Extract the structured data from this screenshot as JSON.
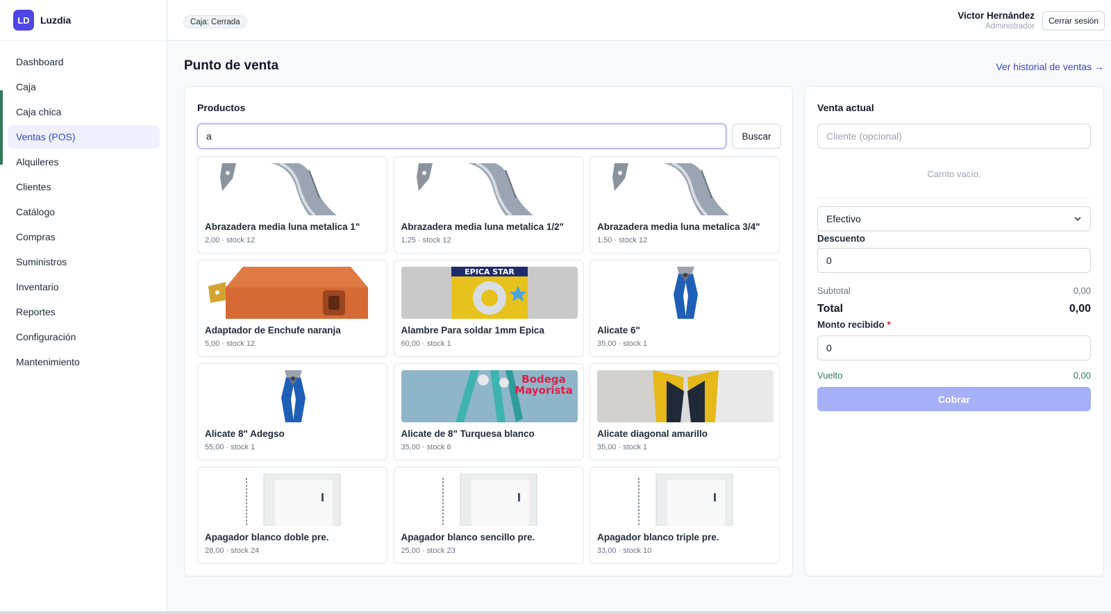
{
  "app": {
    "logo_text": "LD",
    "name": "Luzdia"
  },
  "sidebar": {
    "items": [
      {
        "label": "Dashboard",
        "active": false
      },
      {
        "label": "Caja",
        "active": false
      },
      {
        "label": "Caja chica",
        "active": false
      },
      {
        "label": "Ventas (POS)",
        "active": true
      },
      {
        "label": "Alquileres",
        "active": false
      },
      {
        "label": "Clientes",
        "active": false
      },
      {
        "label": "Catálogo",
        "active": false
      },
      {
        "label": "Compras",
        "active": false
      },
      {
        "label": "Suministros",
        "active": false
      },
      {
        "label": "Inventario",
        "active": false
      },
      {
        "label": "Reportes",
        "active": false
      },
      {
        "label": "Configuración",
        "active": false
      },
      {
        "label": "Mantenimiento",
        "active": false
      }
    ]
  },
  "topbar": {
    "cash_status": "Caja: Cerrada",
    "user_name": "Victor Hernández",
    "user_role": "Administrador",
    "logout_label": "Cerrar sesión"
  },
  "page": {
    "title": "Punto de venta",
    "history_link": "Ver historial de ventas →"
  },
  "products": {
    "title": "Productos",
    "search_value": "a",
    "search_button": "Buscar",
    "items": [
      {
        "name": "Abrazadera media luna metalica 1\"",
        "meta": "2,00 · stock 12",
        "image": "clamp"
      },
      {
        "name": "Abrazadera media luna metalica 1/2\"",
        "meta": "1,25 · stock 12",
        "image": "clamp"
      },
      {
        "name": "Abrazadera media luna metalica 3/4\"",
        "meta": "1,50 · stock 12",
        "image": "clamp"
      },
      {
        "name": "Adaptador de Enchufe naranja",
        "meta": "5,00 · stock 12",
        "image": "plug-adapter"
      },
      {
        "name": "Alambre Para soldar 1mm Epica",
        "meta": "60,00 · stock 1",
        "image": "solder-wire"
      },
      {
        "name": "Alicate 6\"",
        "meta": "35,00 · stock 1",
        "image": "pliers-blue"
      },
      {
        "name": "Alicate 8\" Adegso",
        "meta": "55,00 · stock 1",
        "image": "pliers-blue"
      },
      {
        "name": "Alicate de 8\" Turquesa blanco",
        "meta": "35,00 · stock 6",
        "image": "pliers-turquoise"
      },
      {
        "name": "Alicate diagonal amarillo",
        "meta": "35,00 · stock 1",
        "image": "pliers-yellow"
      },
      {
        "name": "Apagador blanco doble pre.",
        "meta": "28,00 · stock 24",
        "image": "switch"
      },
      {
        "name": "Apagador blanco sencillo pre.",
        "meta": "25,00 · stock 23",
        "image": "switch"
      },
      {
        "name": "Apagador blanco triple pre.",
        "meta": "33,00 · stock 10",
        "image": "switch"
      }
    ]
  },
  "sale": {
    "title": "Venta actual",
    "client_placeholder": "Cliente (opcional)",
    "empty_cart": "Carrito vacío.",
    "payment_method": "Efectivo",
    "discount_label": "Descuento",
    "discount_value": "0",
    "subtotal_label": "Subtotal",
    "subtotal_value": "0,00",
    "total_label": "Total",
    "total_value": "0,00",
    "received_label": "Monto recibido",
    "received_required": "*",
    "received_value": "0",
    "change_label": "Vuelto",
    "change_value": "0,00",
    "charge_button": "Cobrar"
  },
  "colors": {
    "accent": "#4f46e5",
    "nav_active_bg": "#eef1fd",
    "charge_disabled": "#a5b0f7",
    "change_green": "#2f7a5a"
  }
}
